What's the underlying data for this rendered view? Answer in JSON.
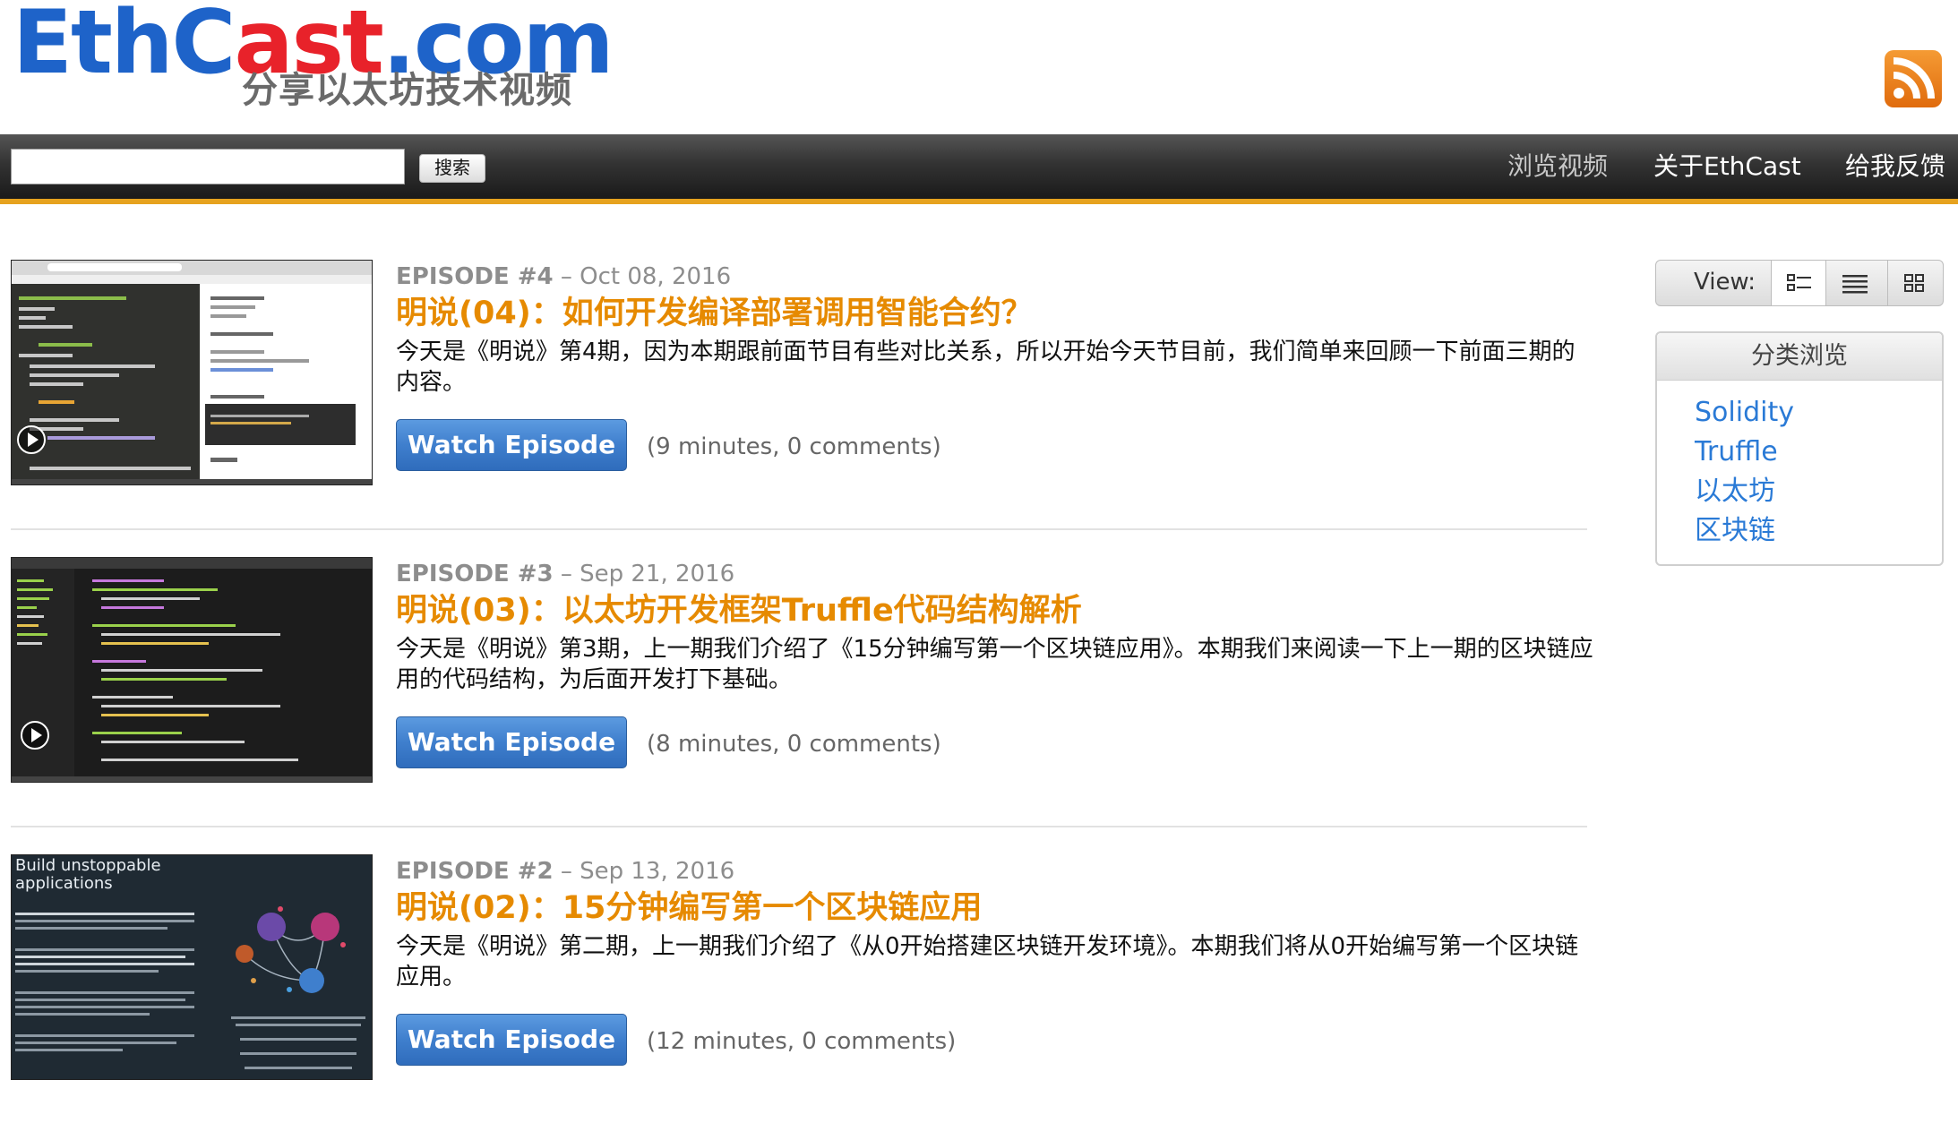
{
  "header": {
    "logo_wordmark_a": "EthC",
    "logo_wordmark_b": "ast",
    "logo_wordmark_c": ".com",
    "logo_tagline": "分享以太坊技术视频",
    "rss_icon": "rss-feed-icon"
  },
  "nav": {
    "search_value": "",
    "search_button": "搜索",
    "links": [
      "浏览视频",
      "关于EthCast",
      "给我反馈"
    ]
  },
  "episodes": [
    {
      "number": "EPISODE #4",
      "date": "– Oct 08, 2016",
      "title": "明说(04)：如何开发编译部署调用智能合约？",
      "description": "今天是《明说》第4期，因为本期跟前面节目有些对比关系，所以开始今天节目前，我们简单来回顾一下前面三期的内容。",
      "button": "Watch Episode",
      "stats": "(9 minutes, 0 comments)"
    },
    {
      "number": "EPISODE #3",
      "date": "– Sep 21, 2016",
      "title": "明说(03)：以太坊开发框架Truffle代码结构解析",
      "description": "今天是《明说》第3期，上一期我们介绍了《15分钟编写第一个区块链应用》。本期我们来阅读一下上一期的区块链应用的代码结构，为后面开发打下基础。",
      "button": "Watch Episode",
      "stats": "(8 minutes, 0 comments)"
    },
    {
      "number": "EPISODE #2",
      "date": "– Sep 13, 2016",
      "title": "明说(02)：15分钟编写第一个区块链应用",
      "description": "今天是《明说》第二期，上一期我们介绍了《从0开始搭建区块链开发环境》。本期我们将从0开始编写第一个区块链应用。",
      "button": "Watch Episode",
      "stats": "(12 minutes, 0 comments)",
      "thumb_heading": "Build unstoppable applications"
    }
  ],
  "sidebar": {
    "view_label": "View:",
    "categories_header": "分类浏览",
    "categories": [
      "Solidity",
      "Truffle",
      "以太坊",
      "区块链"
    ]
  },
  "colors": {
    "accent_orange": "#e68a00",
    "link_blue": "#2a7ad6",
    "button_blue": "#3f7fcd",
    "nav_underline": "#e6a21f"
  }
}
